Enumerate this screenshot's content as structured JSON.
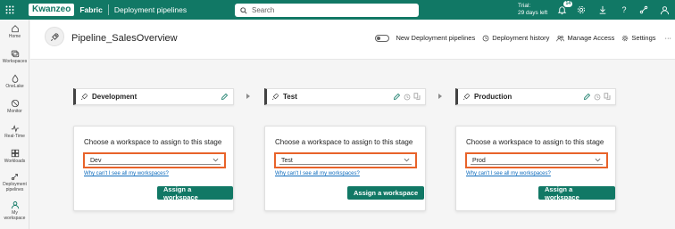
{
  "topbar": {
    "logo": "Kwanzeo",
    "brand": "Fabric",
    "breadcrumb": "Deployment pipelines",
    "search_placeholder": "Search",
    "trial_line1": "Trial:",
    "trial_line2": "29 days left",
    "notification_count": "14",
    "icons": [
      "waffle-icon",
      "bell-icon",
      "gear-icon",
      "download-icon",
      "help-icon",
      "share-icon",
      "avatar-icon"
    ]
  },
  "rail": {
    "items": [
      {
        "label": "Home",
        "icon": "home-icon"
      },
      {
        "label": "Workspaces",
        "icon": "workspaces-icon"
      },
      {
        "label": "OneLake",
        "icon": "onelake-icon"
      },
      {
        "label": "Monitor",
        "icon": "monitor-icon"
      },
      {
        "label": "Real-Time",
        "icon": "realtime-icon"
      },
      {
        "label": "Workloads",
        "icon": "workloads-icon"
      },
      {
        "label_line1": "Deployment",
        "label_line2": "pipelines",
        "icon": "pipelines-icon"
      },
      {
        "label_line1": "My",
        "label_line2": "workspace",
        "icon": "my-workspace-icon"
      }
    ]
  },
  "header": {
    "title": "Pipeline_SalesOverview",
    "new_pipelines_label": "New Deployment pipelines",
    "history_label": "Deployment history",
    "access_label": "Manage Access",
    "settings_label": "Settings",
    "more_label": "···"
  },
  "stages": [
    {
      "name": "Development",
      "title": "Choose a workspace to assign to this stage",
      "selected": "Dev",
      "link": "Why can't I see all my workspaces?",
      "button": "Assign a workspace"
    },
    {
      "name": "Test",
      "title": "Choose a workspace to assign to this stage",
      "selected": "Test",
      "link": "Why can't I see all my workspaces?",
      "button": "Assign a workspace"
    },
    {
      "name": "Production",
      "title": "Choose a workspace to assign to this stage",
      "selected": "Prod",
      "link": "Why can't I see all my workspaces?",
      "button": "Assign a workspace"
    }
  ],
  "colors": {
    "accent": "#117865",
    "highlight": "#e8632a",
    "link": "#0f6cbd"
  }
}
